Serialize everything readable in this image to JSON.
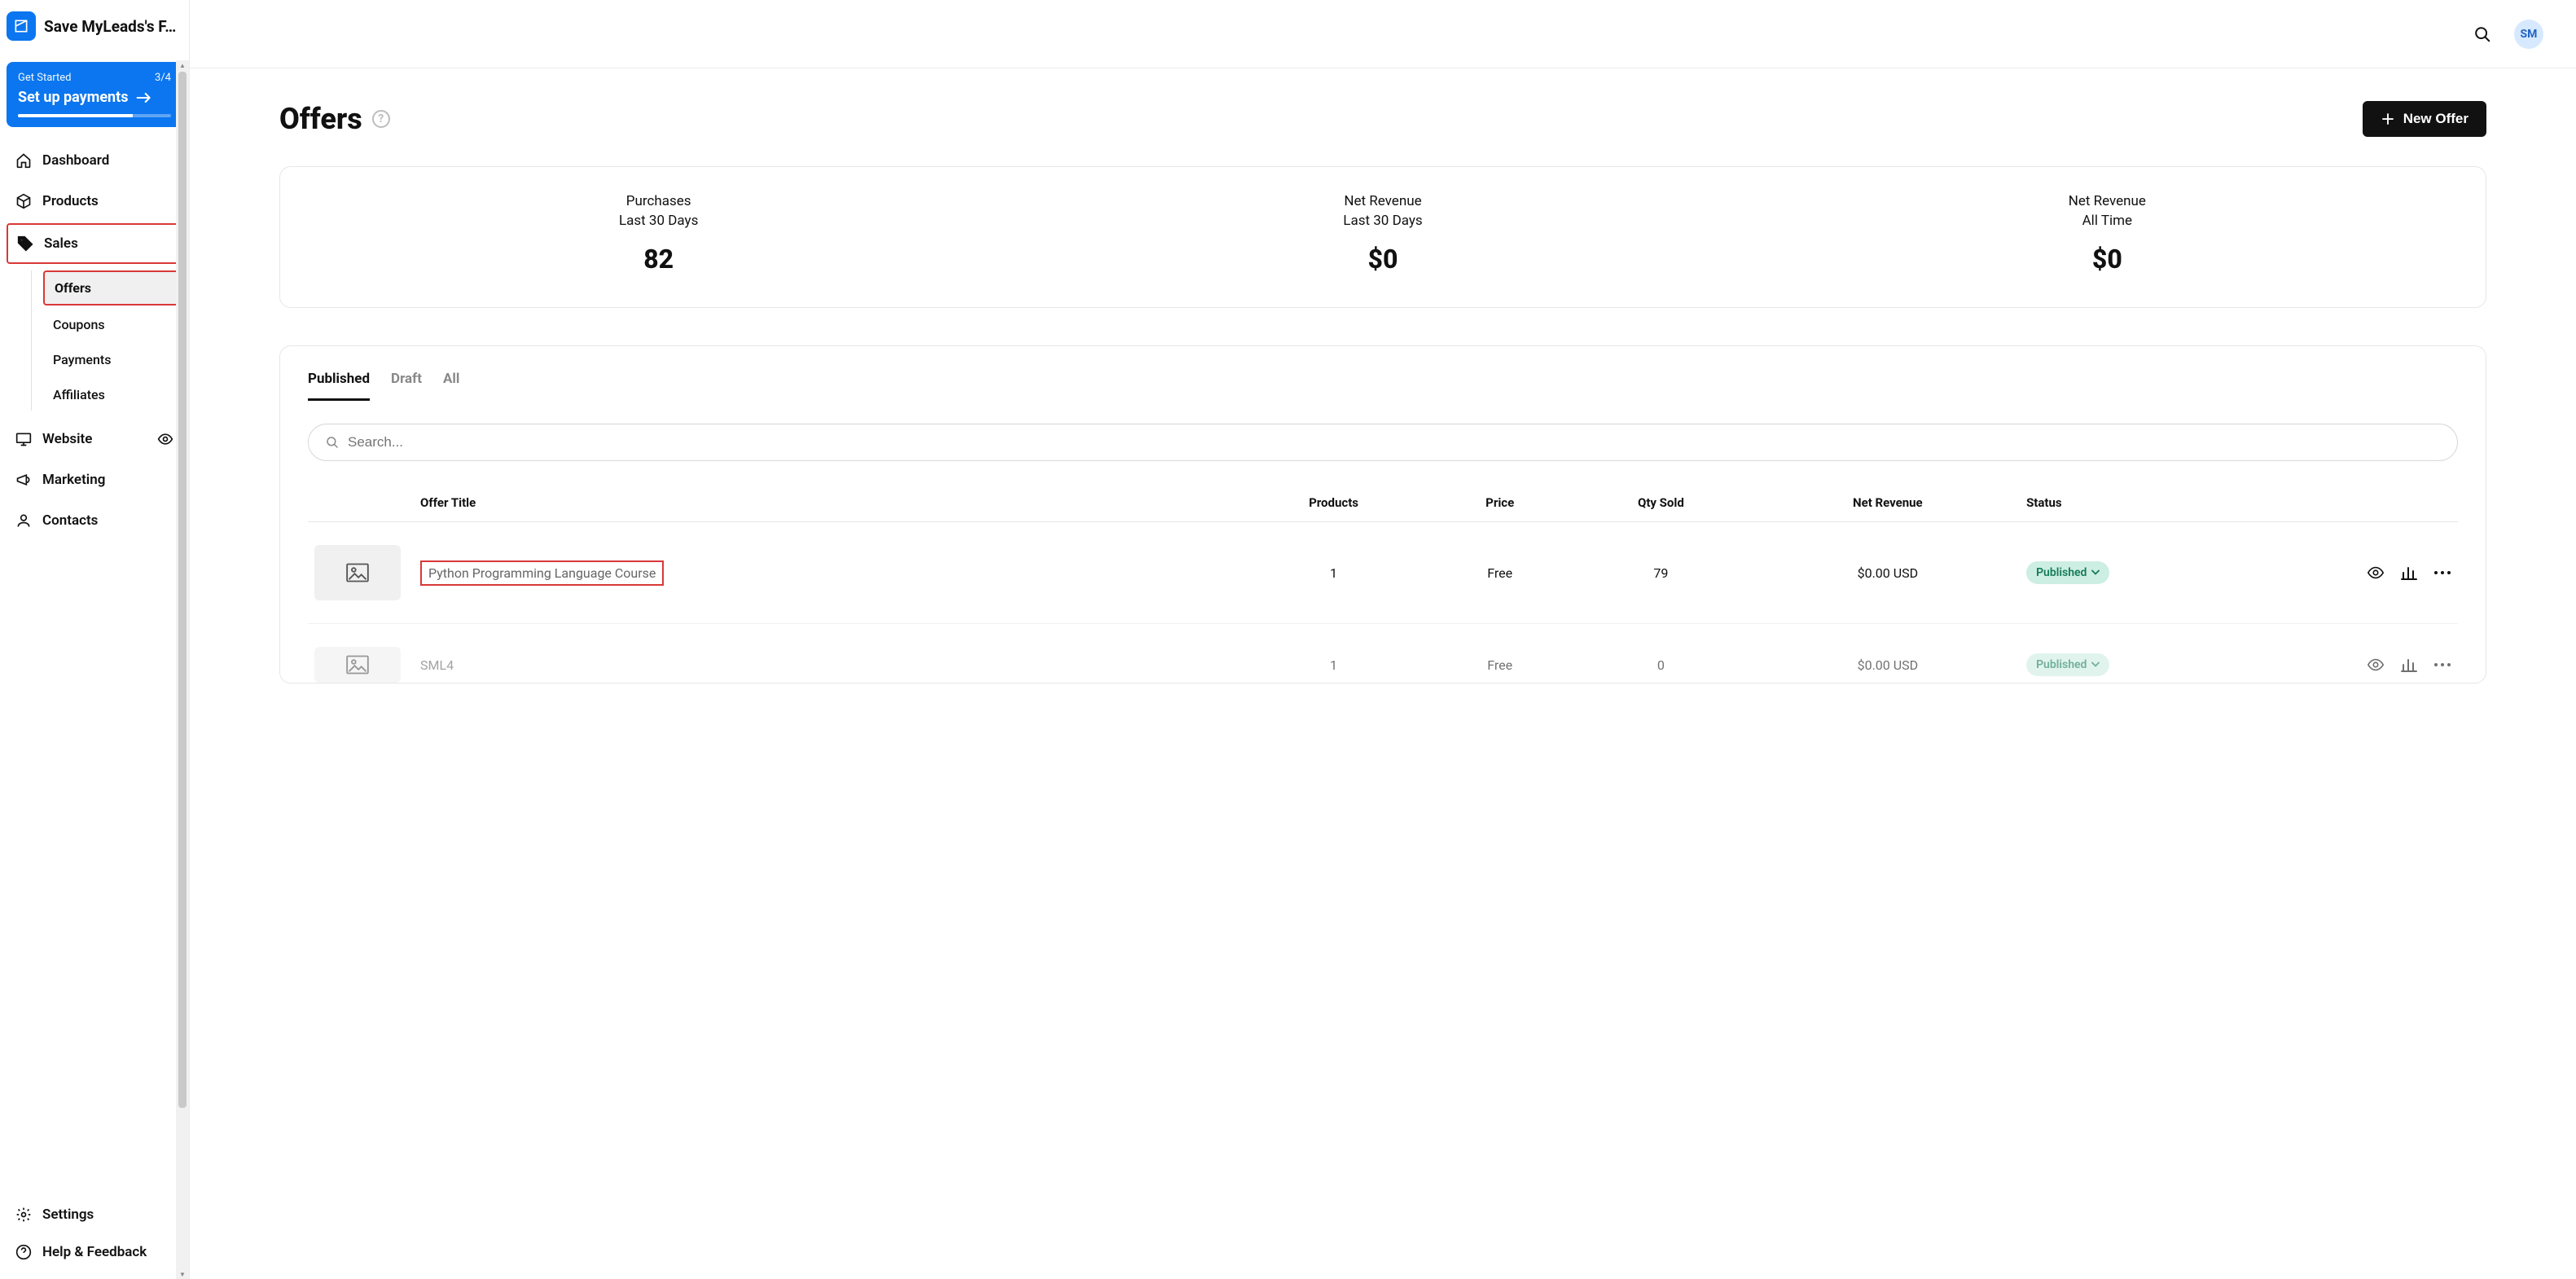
{
  "app": {
    "title": "Save MyLeads's F…"
  },
  "get_started": {
    "label": "Get Started",
    "progress": "3/4",
    "cta": "Set up payments"
  },
  "sidebar": {
    "items": [
      {
        "label": "Dashboard"
      },
      {
        "label": "Products"
      },
      {
        "label": "Sales"
      },
      {
        "label": "Website"
      },
      {
        "label": "Marketing"
      },
      {
        "label": "Contacts"
      }
    ],
    "sales_sub": [
      {
        "label": "Offers"
      },
      {
        "label": "Coupons"
      },
      {
        "label": "Payments"
      },
      {
        "label": "Affiliates"
      }
    ],
    "footer": [
      {
        "label": "Settings"
      },
      {
        "label": "Help & Feedback"
      }
    ]
  },
  "avatar": {
    "initials": "SM"
  },
  "page": {
    "title": "Offers",
    "new_offer": "New Offer"
  },
  "stats": [
    {
      "label": "Purchases",
      "sub": "Last 30 Days",
      "value": "82"
    },
    {
      "label": "Net Revenue",
      "sub": "Last 30 Days",
      "value": "$0"
    },
    {
      "label": "Net Revenue",
      "sub": "All Time",
      "value": "$0"
    }
  ],
  "tabs": [
    {
      "label": "Published",
      "active": true
    },
    {
      "label": "Draft"
    },
    {
      "label": "All"
    }
  ],
  "search": {
    "placeholder": "Search..."
  },
  "columns": {
    "title": "Offer Title",
    "products": "Products",
    "price": "Price",
    "qty": "Qty Sold",
    "net": "Net Revenue",
    "status": "Status"
  },
  "rows": [
    {
      "title": "Python Programming Language Course",
      "products": "1",
      "price": "Free",
      "qty": "79",
      "net": "$0.00 USD",
      "status": "Published",
      "highlighted": true
    },
    {
      "title": "SML4",
      "products": "1",
      "price": "Free",
      "qty": "0",
      "net": "$0.00 USD",
      "status": "Published"
    }
  ]
}
